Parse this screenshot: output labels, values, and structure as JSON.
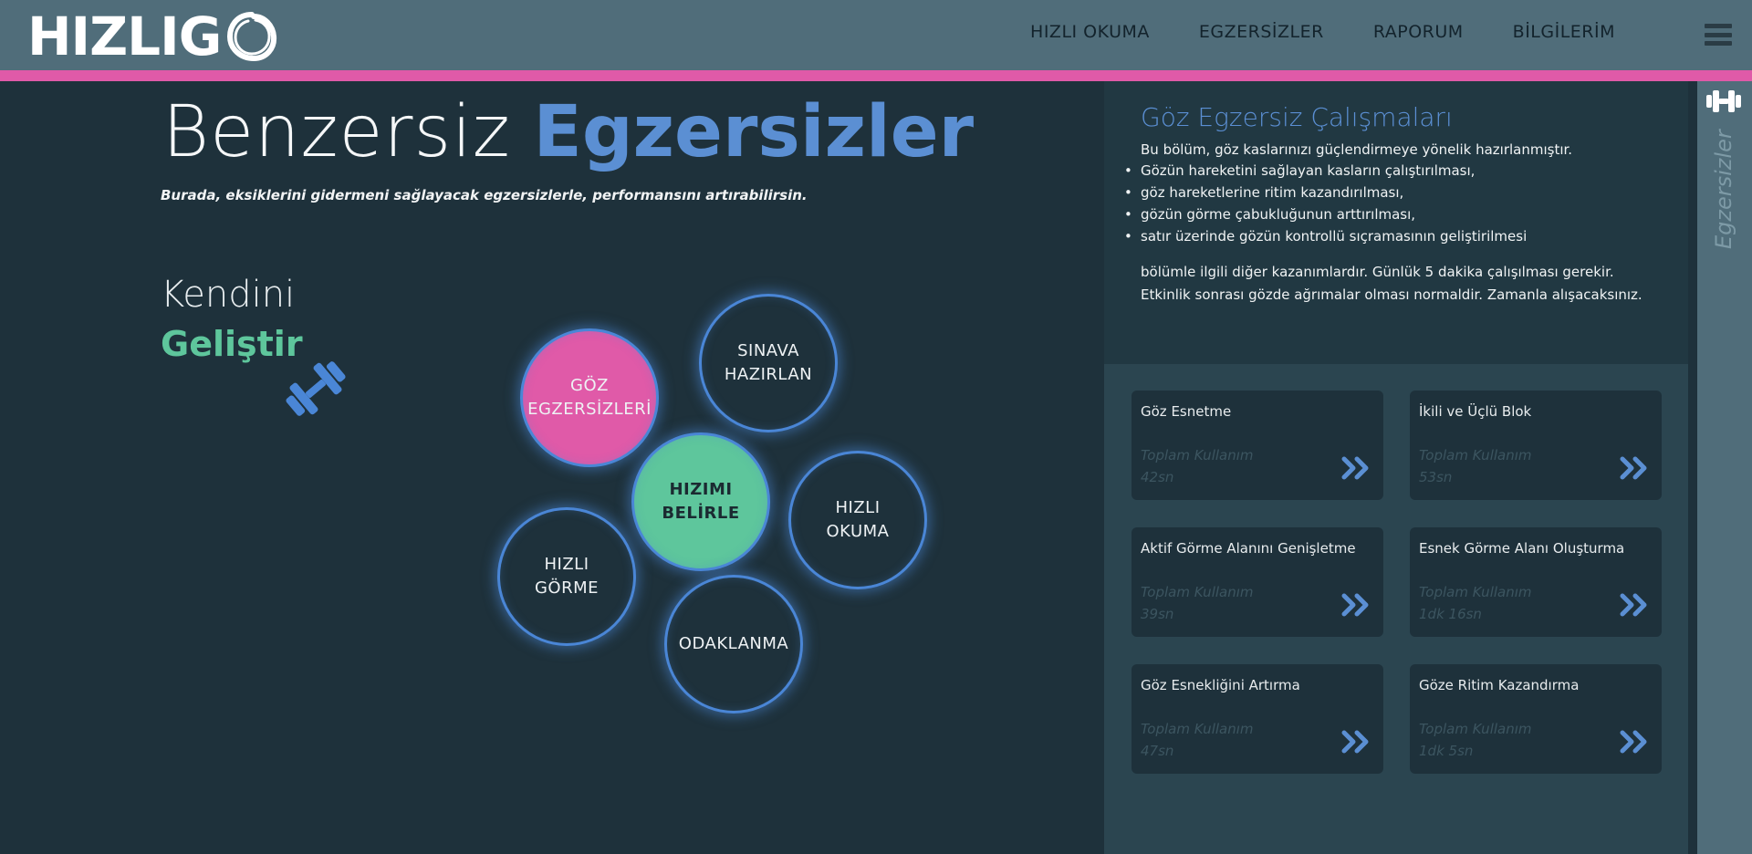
{
  "brand": {
    "logo_text": "HIZLIG"
  },
  "nav": {
    "items": [
      {
        "label": "HIZLI OKUMA"
      },
      {
        "label": "EGZERSİZLER"
      },
      {
        "label": "RAPORUM"
      },
      {
        "label": "BİLGİLERİM"
      }
    ]
  },
  "hero": {
    "title_light": "Benzersiz",
    "title_bold": "Egzersizler",
    "subtitle": "Burada, eksiklerini gidermeni sağlayacak egzersizlerle, performansını artırabilirsin."
  },
  "left": {
    "kendini": "Kendini",
    "gelistir": "Geliştir"
  },
  "bubbles": [
    {
      "line1": "GÖZ",
      "line2": "EGZERSİZLERİ"
    },
    {
      "line1": "SINAVA",
      "line2": "HAZIRLAN"
    },
    {
      "line1": "HIZIMI",
      "line2": "BELİRLE"
    },
    {
      "line1": "HIZLI",
      "line2": "OKUMA"
    },
    {
      "line1": "HIZLI",
      "line2": "GÖRME"
    },
    {
      "line1": "ODAKLANMA",
      "line2": ""
    }
  ],
  "info": {
    "title": "Göz Egzersiz Çalışmaları",
    "intro": "Bu bölüm, göz kaslarınızı güçlendirmeye yönelik hazırlanmıştır.",
    "bullets": [
      "Gözün hareketini sağlayan kasların çalıştırılması,",
      "göz hareketlerine ritim kazandırılması,",
      "gözün görme çabukluğunun arttırılması,",
      "satır üzerinde gözün kontrollü sıçramasının geliştirilmesi"
    ],
    "outro": "bölümle ilgili diğer kazanımlardır. Günlük 5 dakika çalışılması gerekir. Etkinlik sonrası gözde ağrımalar olması normaldir. Zamanla alışacaksınız."
  },
  "cards": [
    {
      "title": "Göz Esnetme",
      "usage_label": "Toplam Kullanım",
      "usage_value": "42sn"
    },
    {
      "title": "İkili ve Üçlü Blok",
      "usage_label": "Toplam Kullanım",
      "usage_value": "53sn"
    },
    {
      "title": "Aktif Görme Alanını Genişletme",
      "usage_label": "Toplam Kullanım",
      "usage_value": "39sn"
    },
    {
      "title": "Esnek Görme Alanı Oluşturma",
      "usage_label": "Toplam Kullanım",
      "usage_value": "1dk 16sn"
    },
    {
      "title": "Göz Esnekliğini Artırma",
      "usage_label": "Toplam Kullanım",
      "usage_value": "47sn"
    },
    {
      "title": "Göze Ritim Kazandırma",
      "usage_label": "Toplam Kullanım",
      "usage_value": "1dk 5sn"
    }
  ],
  "side": {
    "label": "Egzersizler"
  },
  "icons": {
    "menu": "hamburger-menu-icon",
    "dumbbell": "dumbbell-icon",
    "go": "double-chevron-right-icon"
  },
  "colors": {
    "background": "#1e313b",
    "header": "#506d7a",
    "accent_pink": "#e05aa8",
    "accent_blue": "#5b8fd3",
    "accent_green": "#5ec69c"
  }
}
